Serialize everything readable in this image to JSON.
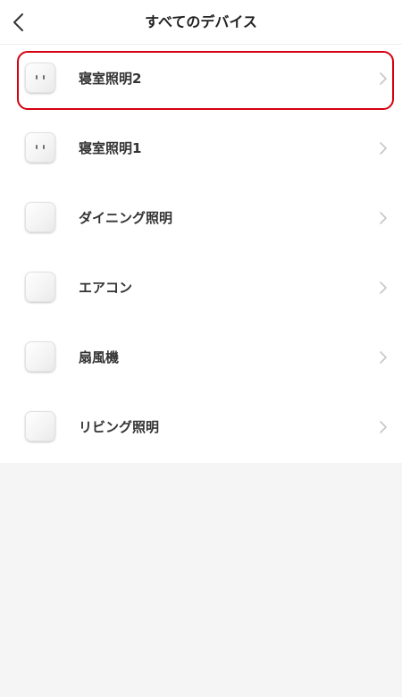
{
  "header": {
    "title": "すべてのデバイス",
    "back_icon": "chevron-left-icon"
  },
  "devices": [
    {
      "name": "寝室照明2",
      "icon": "smart-plug-icon",
      "highlighted": true
    },
    {
      "name": "寝室照明1",
      "icon": "smart-plug-icon",
      "highlighted": false
    },
    {
      "name": "ダイニング照明",
      "icon": "device-blank-icon",
      "highlighted": false
    },
    {
      "name": "エアコン",
      "icon": "device-blank-icon",
      "highlighted": false
    },
    {
      "name": "扇風機",
      "icon": "device-blank-icon",
      "highlighted": false
    },
    {
      "name": "リビング照明",
      "icon": "device-blank-icon",
      "highlighted": false
    }
  ],
  "colors": {
    "highlight_border": "#d6000f",
    "background": "#f5f5f5",
    "list_background": "#ffffff",
    "text": "#333333",
    "chevron": "#c7c7c7"
  }
}
